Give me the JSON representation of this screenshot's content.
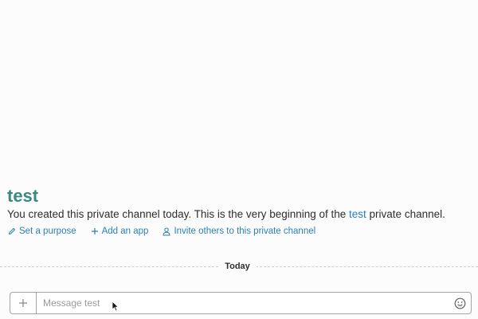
{
  "channel": {
    "name": "test",
    "intro_prefix": "You created this private channel today. This is the very beginning of the ",
    "intro_link": "test",
    "intro_suffix": " private channel."
  },
  "actions": [
    {
      "label": "Set a purpose",
      "icon": "pencil-icon"
    },
    {
      "label": "Add an app",
      "icon": "plus-icon"
    },
    {
      "label": "Invite others to this private channel",
      "icon": "person-icon"
    }
  ],
  "divider": {
    "label": "Today"
  },
  "composer": {
    "placeholder": "Message test",
    "value": "",
    "attach_icon": "plus-icon",
    "emoji_icon": "smiley-icon"
  },
  "colors": {
    "channel_title": "#3a8a83",
    "link": "#2a7fb5",
    "text": "#2c2d30",
    "background": "#fcfcfc"
  }
}
